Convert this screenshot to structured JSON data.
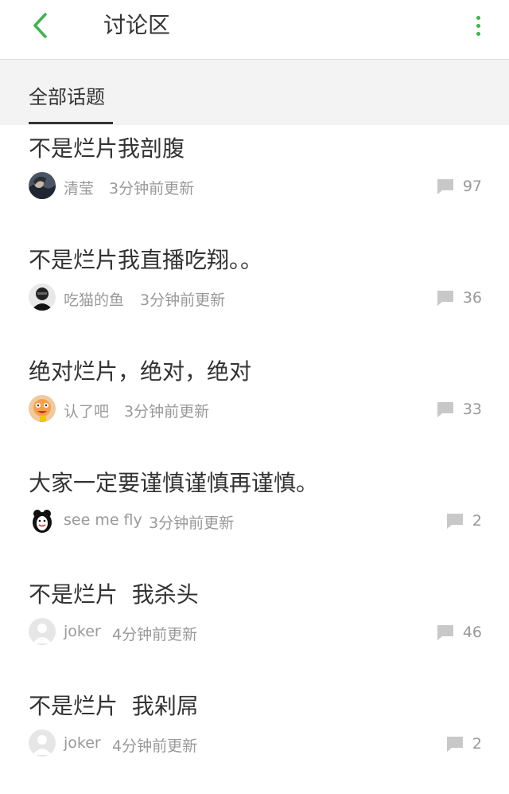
{
  "header": {
    "title": "讨论区",
    "back_icon": "chevron-left-icon",
    "more_icon": "more-vertical-icon",
    "accent": "#3cb64a"
  },
  "tabs": [
    {
      "label": "全部话题",
      "active": true
    }
  ],
  "topics": [
    {
      "title": "不是烂片我剖腹",
      "author": "清莹",
      "time": "3分钟前更新",
      "comments": "97"
    },
    {
      "title": "不是烂片我直播吃翔。。",
      "author": "吃猫的鱼",
      "time": "3分钟前更新",
      "comments": "36"
    },
    {
      "title": "绝对烂片，绝对，绝对",
      "author": "认了吧",
      "time": "3分钟前更新",
      "comments": "33"
    },
    {
      "title": "大家一定要谨慎谨慎再谨慎。",
      "author": "see me fly",
      "time": "3分钟前更新",
      "comments": "2"
    },
    {
      "title": "不是烂片  我杀头",
      "author": "joker",
      "time": "4分钟前更新",
      "comments": "46"
    },
    {
      "title": "不是烂片  我剁屌",
      "author": "joker",
      "time": "4分钟前更新",
      "comments": "2"
    }
  ]
}
